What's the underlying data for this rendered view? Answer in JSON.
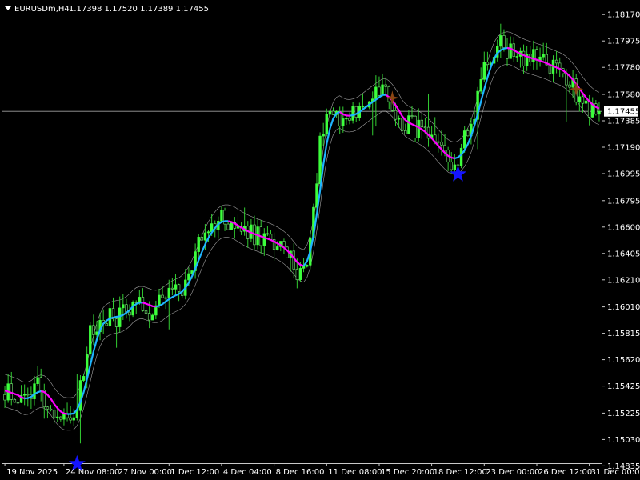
{
  "header": {
    "dropdown_icon": "triangle-down-icon",
    "symbol": "EURUSDm,H4",
    "ohlc": "1.17398 1.17520 1.17389 1.17455"
  },
  "current_price": {
    "label": "1.17455",
    "value": 1.17455,
    "line_color": "#a0a0a0"
  },
  "colors": {
    "background": "#000000",
    "frame": "#c8c8c8",
    "candle_bull": "#3cff3c",
    "candle_bear": "#78e678",
    "wick": "#32cd32",
    "ma_up": "#1eb4ff",
    "ma_down": "#ff00ff",
    "band": "#c8c8c8",
    "buy_signal": "#1414ff",
    "sell_signal": "#8b4513"
  },
  "chart_data": {
    "type": "candlestick",
    "title": "EURUSDm,H4",
    "ylim": [
      1.14855,
      1.1826
    ],
    "y_ticks": [
      "1.18170",
      "1.17975",
      "1.17780",
      "1.17580",
      "1.17385",
      "1.17190",
      "1.16995",
      "1.16795",
      "1.16600",
      "1.16405",
      "1.16210",
      "1.16010",
      "1.15815",
      "1.15620",
      "1.15425",
      "1.15225",
      "1.15030",
      "1.14835"
    ],
    "x_ticks": [
      "19 Nov 2025",
      "24 Nov 08:00",
      "27 Nov 00:00",
      "1 Dec 12:00",
      "4 Dec 04:00",
      "8 Dec 16:00",
      "11 Dec 08:00",
      "15 Dec 20:00",
      "18 Dec 12:00",
      "23 Dec 00:00",
      "26 Dec 12:00",
      "31 Dec 00:00"
    ],
    "x_tick_index": [
      0,
      18,
      34,
      50,
      66,
      82,
      98,
      114,
      130,
      146,
      162,
      178
    ],
    "bar_count": 182,
    "close_path": [
      [
        0,
        1.154
      ],
      [
        6,
        1.153
      ],
      [
        10,
        1.1545
      ],
      [
        14,
        1.1525
      ],
      [
        18,
        1.152
      ],
      [
        22,
        1.1525
      ],
      [
        26,
        1.158
      ],
      [
        30,
        1.1595
      ],
      [
        34,
        1.1592
      ],
      [
        40,
        1.1608
      ],
      [
        44,
        1.1598
      ],
      [
        50,
        1.161
      ],
      [
        54,
        1.1612
      ],
      [
        58,
        1.164
      ],
      [
        62,
        1.166
      ],
      [
        66,
        1.1667
      ],
      [
        70,
        1.166
      ],
      [
        74,
        1.1655
      ],
      [
        78,
        1.1652
      ],
      [
        82,
        1.1648
      ],
      [
        86,
        1.164
      ],
      [
        90,
        1.1625
      ],
      [
        92,
        1.1635
      ],
      [
        96,
        1.172
      ],
      [
        98,
        1.175
      ],
      [
        100,
        1.1745
      ],
      [
        104,
        1.174
      ],
      [
        108,
        1.1748
      ],
      [
        112,
        1.1755
      ],
      [
        116,
        1.1762
      ],
      [
        118,
        1.1745
      ],
      [
        120,
        1.1738
      ],
      [
        124,
        1.1735
      ],
      [
        128,
        1.1728
      ],
      [
        132,
        1.1715
      ],
      [
        136,
        1.1708
      ],
      [
        138,
        1.1712
      ],
      [
        142,
        1.1735
      ],
      [
        146,
        1.178
      ],
      [
        150,
        1.1795
      ],
      [
        154,
        1.179
      ],
      [
        158,
        1.1785
      ],
      [
        162,
        1.1783
      ],
      [
        166,
        1.1778
      ],
      [
        170,
        1.1775
      ],
      [
        174,
        1.176
      ],
      [
        178,
        1.1748
      ],
      [
        181,
        1.17455
      ]
    ],
    "signals": [
      {
        "type": "buy",
        "bar": 22,
        "price": 1.1485
      },
      {
        "type": "sell",
        "bar": 118,
        "price": 1.17555
      },
      {
        "type": "buy",
        "bar": 138,
        "price": 1.1699
      },
      {
        "type": "sell",
        "bar": 174,
        "price": 1.1762
      }
    ],
    "indicators": [
      "moving-average (two-color)",
      "envelope bands"
    ]
  }
}
